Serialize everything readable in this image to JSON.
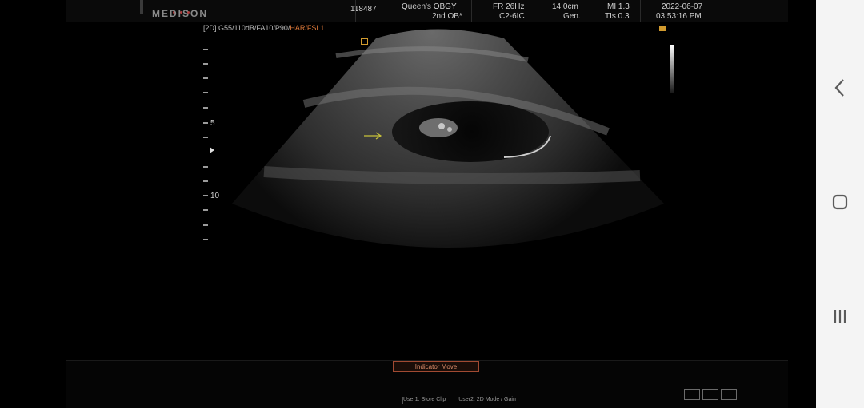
{
  "header": {
    "logo": "MEDISON",
    "patient_id": "118487",
    "institution": "Queen's OBGY",
    "study": "2nd OB*",
    "frame_rate": "FR 26Hz",
    "probe": "C2-6IC",
    "depth": "14.0cm",
    "preset": "Gen.",
    "mi": "MI 1.3",
    "tis": "TIs 0.3",
    "date": "2022-06-07",
    "time": "03:53:16 PM"
  },
  "imaging": {
    "params_main": "[2D] G55/110dB/FA10/P90/",
    "params_highlight": "HAR/FSI 1"
  },
  "depth_scale": {
    "label_5": "5",
    "label_10": "10"
  },
  "controls": {
    "indicator_button": "Indicator Move",
    "user1": "User1. Store Clip",
    "user2": "User2. 2D Mode / Gain"
  },
  "colors": {
    "accent_orange": "#d19a2e",
    "arrow_yellow": "#c8c23a",
    "button_border": "#a14a32"
  },
  "nav": {
    "icons": [
      "back-icon",
      "home-icon",
      "recent-apps-icon"
    ]
  }
}
